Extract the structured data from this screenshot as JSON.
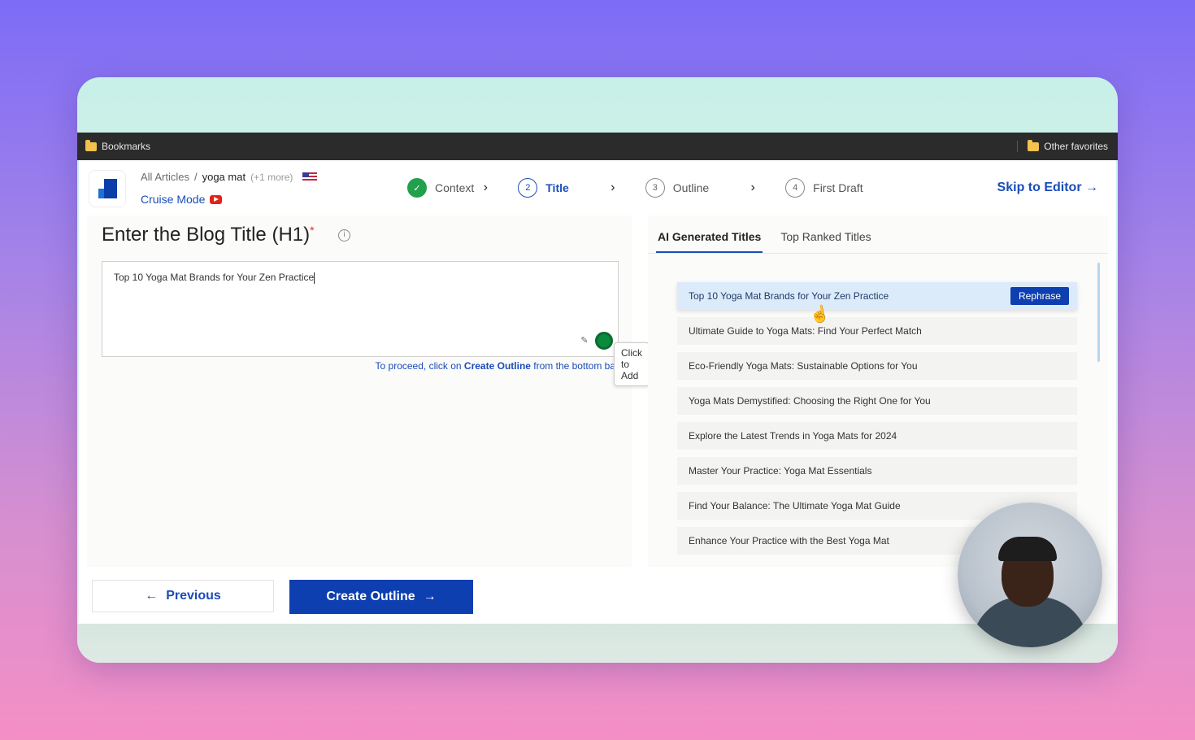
{
  "browser": {
    "bookmarks_label": "Bookmarks",
    "other_favorites_label": "Other favorites"
  },
  "header": {
    "breadcrumb_all": "All Articles",
    "breadcrumb_sep": "/",
    "breadcrumb_current": "yoga mat",
    "breadcrumb_more": "(+1 more)",
    "cruise_mode": "Cruise Mode",
    "skip_to_editor": "Skip to Editor →",
    "steps": [
      {
        "num": "✓",
        "label": "Context",
        "state": "done"
      },
      {
        "num": "2",
        "label": "Title",
        "state": "active"
      },
      {
        "num": "3",
        "label": "Outline",
        "state": "pending"
      },
      {
        "num": "4",
        "label": "First Draft",
        "state": "pending"
      }
    ]
  },
  "left": {
    "heading": "Enter the Blog Title (H1)",
    "required_mark": "*",
    "title_value": "Top 10 Yoga Mat Brands for Your Zen Practice",
    "hint_prefix": "To proceed, click on ",
    "hint_link": "Create Outline",
    "hint_suffix": " from the bottom bar",
    "tooltip": "Click to Add"
  },
  "right": {
    "tabs": [
      "AI Generated Titles",
      "Top Ranked Titles"
    ],
    "rephrase_label": "Rephrase",
    "titles": [
      "Top 10 Yoga Mat Brands for Your Zen Practice",
      "Ultimate Guide to Yoga Mats: Find Your Perfect Match",
      "Eco-Friendly Yoga Mats: Sustainable Options for You",
      "Yoga Mats Demystified: Choosing the Right One for You",
      "Explore the Latest Trends in Yoga Mats for 2024",
      "Master Your Practice: Yoga Mat Essentials",
      "Find Your Balance: The Ultimate Yoga Mat Guide",
      "Enhance Your Practice with the Best Yoga Mat"
    ]
  },
  "footer": {
    "previous_label": "Previous",
    "create_outline_label": "Create Outline"
  },
  "colors": {
    "accent": "#1a4db8",
    "primary_button": "#0d3fb0",
    "success": "#22a04b"
  }
}
